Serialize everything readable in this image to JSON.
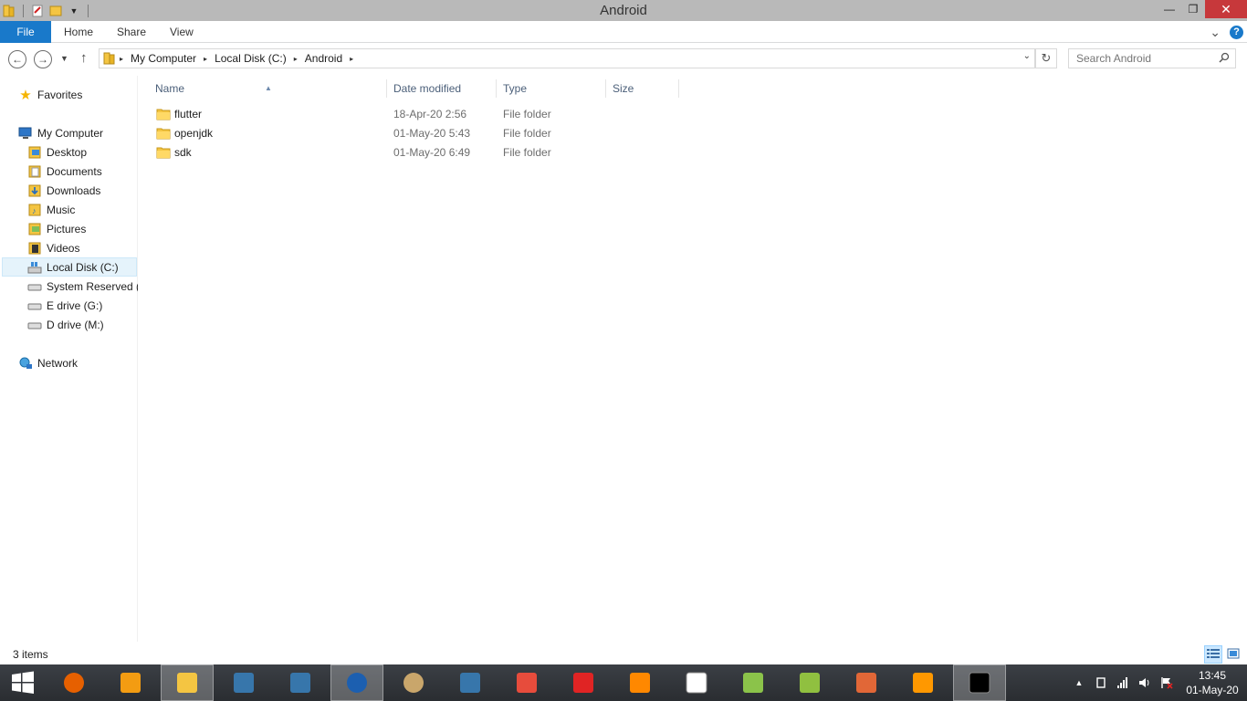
{
  "window": {
    "title": "Android",
    "minimize_glyph": "—",
    "maximize_glyph": "❐",
    "close_glyph": "✕"
  },
  "ribbon": {
    "tabs": [
      {
        "label": "File"
      },
      {
        "label": "Home"
      },
      {
        "label": "Share"
      },
      {
        "label": "View"
      }
    ],
    "help_glyph": "?",
    "expand_glyph": "⌄"
  },
  "address": {
    "breadcrumbs": [
      "My Computer",
      "Local Disk (C:)",
      "Android"
    ],
    "separator": "▸",
    "dropdown_glyph": "⌄"
  },
  "search": {
    "placeholder": "Search Android"
  },
  "nav": {
    "favorites": "Favorites",
    "computer": "My Computer",
    "items": [
      {
        "label": "Desktop",
        "icon": "desktop-icon"
      },
      {
        "label": "Documents",
        "icon": "documents-icon"
      },
      {
        "label": "Downloads",
        "icon": "downloads-icon"
      },
      {
        "label": "Music",
        "icon": "music-icon"
      },
      {
        "label": "Pictures",
        "icon": "pictures-icon"
      },
      {
        "label": "Videos",
        "icon": "videos-icon"
      },
      {
        "label": "Local Disk (C:)",
        "icon": "local-disk-icon"
      },
      {
        "label": "System Reserved (D",
        "icon": "drive-icon"
      },
      {
        "label": "E drive (G:)",
        "icon": "drive-icon"
      },
      {
        "label": "D drive (M:)",
        "icon": "drive-icon"
      }
    ],
    "network": "Network"
  },
  "columns": {
    "name": "Name",
    "date": "Date modified",
    "type": "Type",
    "size": "Size"
  },
  "files": [
    {
      "name": "flutter",
      "date": "18-Apr-20 2:56",
      "type": "File folder"
    },
    {
      "name": "openjdk",
      "date": "01-May-20 5:43",
      "type": "File folder"
    },
    {
      "name": "sdk",
      "date": "01-May-20 6:49",
      "type": "File folder"
    }
  ],
  "status": {
    "item_count": "3 items"
  },
  "taskbar": {
    "apps": [
      {
        "name": "firefox-icon",
        "color": "#e66000"
      },
      {
        "name": "media-player-icon",
        "color": "#f39c12"
      },
      {
        "name": "file-explorer-icon",
        "color": "#f4c542"
      },
      {
        "name": "python-icon",
        "color": "#3776ab"
      },
      {
        "name": "python-icon",
        "color": "#3776ab"
      },
      {
        "name": "eagle-browser-icon",
        "color": "#1c5fb0"
      },
      {
        "name": "planet-icon",
        "color": "#c9a66b"
      },
      {
        "name": "python-icon",
        "color": "#3776ab"
      },
      {
        "name": "office-icon",
        "color": "#e74c3c"
      },
      {
        "name": "red-cross-icon",
        "color": "#e02424"
      },
      {
        "name": "vlc-icon",
        "color": "#ff8800"
      },
      {
        "name": "chess-icon",
        "color": "#ffffff"
      },
      {
        "name": "zip-icon",
        "color": "#8bc34a"
      },
      {
        "name": "notepad-plus-icon",
        "color": "#90c040"
      },
      {
        "name": "matlab-icon",
        "color": "#e16737"
      },
      {
        "name": "sublime-icon",
        "color": "#ff9800"
      },
      {
        "name": "command-prompt-icon",
        "color": "#000000"
      }
    ],
    "time": "13:45",
    "date": "01-May-20",
    "tray_up_glyph": "▲"
  },
  "colors": {
    "accent": "#1979ca",
    "close_red": "#c7383b",
    "header_text": "#4c607a",
    "folder_yellow": "#f4c542"
  }
}
